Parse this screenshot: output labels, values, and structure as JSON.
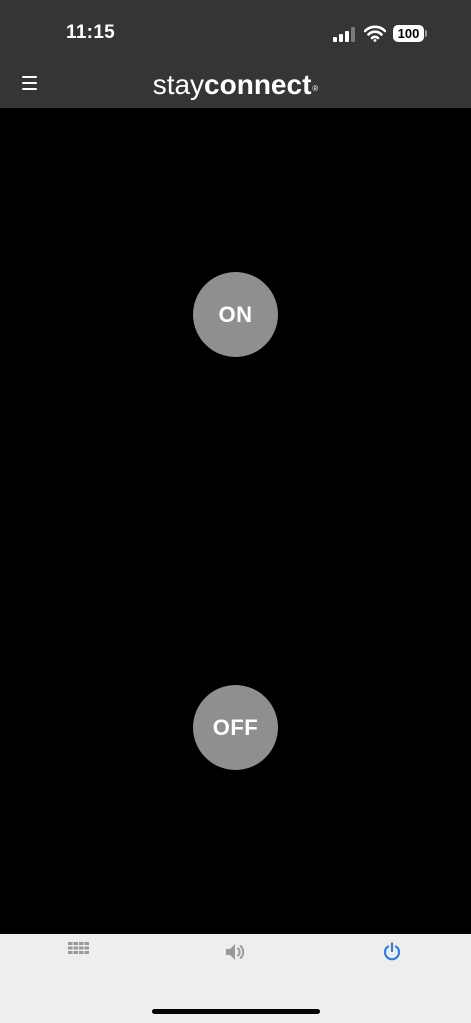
{
  "status_bar": {
    "time": "11:15",
    "battery_level": "100",
    "signal_icon": "cellular-signal-icon",
    "wifi_icon": "wifi-icon"
  },
  "app_bar": {
    "menu_icon": "hamburger-menu-icon",
    "logo": {
      "light_text": "stay",
      "bold_text": "connect",
      "registered_mark": "®"
    }
  },
  "controls": {
    "on_label": "ON",
    "off_label": "OFF"
  },
  "tab_bar": {
    "tabs": [
      {
        "icon": "grid-icon",
        "active": false
      },
      {
        "icon": "speaker-icon",
        "active": false
      },
      {
        "icon": "power-icon",
        "active": true
      }
    ],
    "active_color": "#2f7fd6",
    "inactive_color": "#9a9a9a"
  },
  "colors": {
    "header_bg": "#353535",
    "main_bg": "#000000",
    "button_bg": "#8f8f90",
    "tabbar_bg": "#eeeeee"
  }
}
